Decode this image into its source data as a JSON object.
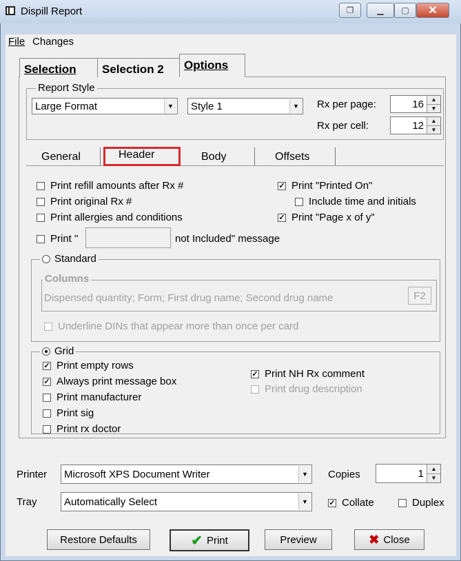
{
  "window": {
    "title": "Dispill Report"
  },
  "menu": {
    "file": "File",
    "changes": "Changes"
  },
  "tabs": {
    "selection": "Selection",
    "selection2": "Selection 2",
    "options": "Options"
  },
  "report_style": {
    "legend": "Report Style",
    "format": "Large Format",
    "style": "Style 1",
    "rx_per_page_label": "Rx per page:",
    "rx_per_page": "16",
    "rx_per_cell_label": "Rx per cell:",
    "rx_per_cell": "12"
  },
  "subtabs": {
    "general": "General",
    "header": "Header",
    "body": "Body",
    "offsets": "Offsets"
  },
  "header_opts": {
    "refill": "Print refill amounts after Rx #",
    "original": "Print original Rx #",
    "allergies": "Print allergies and conditions",
    "print_prefix": "Print \"",
    "not_included": "not Included\" message",
    "printed_on": "Print \"Printed On\"",
    "include_time": "Include time and initials",
    "page_x_of_y": "Print \"Page x of y\""
  },
  "standard": {
    "label": "Standard",
    "columns_legend": "Columns",
    "columns_text": "Dispensed quantity; Form; First drug name; Second drug name",
    "f2": "F2",
    "underline": "Underline DINs that appear more than once per card"
  },
  "grid": {
    "label": "Grid",
    "empty_rows": "Print empty rows",
    "message_box": "Always print message box",
    "manufacturer": "Print manufacturer",
    "sig": "Print sig",
    "rx_doctor": "Print  rx doctor",
    "nh_comment": "Print NH Rx comment",
    "drug_desc": "Print drug description"
  },
  "printer": {
    "label": "Printer",
    "value": "Microsoft XPS Document Writer",
    "copies_label": "Copies",
    "copies": "1",
    "tray_label": "Tray",
    "tray": "Automatically Select",
    "collate": "Collate",
    "duplex": "Duplex"
  },
  "buttons": {
    "restore": "Restore Defaults",
    "print": "Print",
    "preview": "Preview",
    "close": "Close"
  },
  "colors": {
    "highlight": "#d9282f",
    "print_check": "#1f9e1f",
    "close_x": "#c00000"
  }
}
